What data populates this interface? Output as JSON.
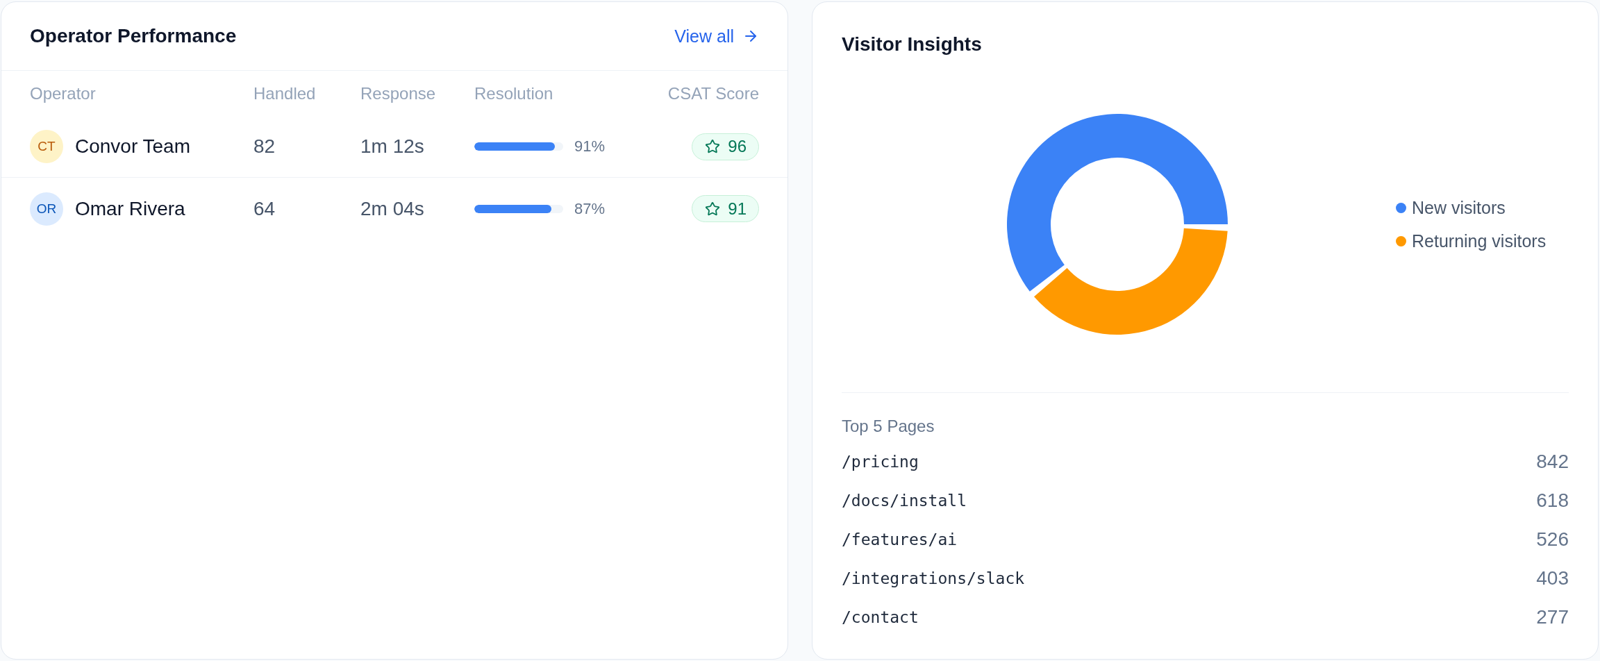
{
  "operator_performance": {
    "title": "Operator Performance",
    "view_all": {
      "label": "View all"
    },
    "columns": [
      "Operator",
      "Handled",
      "Response",
      "Resolution",
      "CSAT Score"
    ],
    "rows": [
      {
        "initials": "CT",
        "color": "#fef3c7",
        "name": "Convor Team",
        "handled": "82",
        "response": "1m 12s",
        "resolution": {
          "level": 0.91,
          "reading": "91%"
        },
        "csat": "96"
      },
      {
        "initials": "OR",
        "color": "#dbeafe",
        "name": "Omar Rivera",
        "handled": "64",
        "response": "2m 04s",
        "resolution": {
          "level": 0.87,
          "reading": "87%"
        },
        "csat": "91"
      }
    ]
  },
  "visitor_insights": {
    "title": "Visitor Insights",
    "legend": [
      {
        "label": "New visitors",
        "color": "#3b82f6"
      },
      {
        "label": "Returning visitors",
        "color": "#ff9900"
      }
    ],
    "top_pages": {
      "title": "Top 5 Pages",
      "rows": [
        {
          "path": "/pricing",
          "count": "842"
        },
        {
          "path": "/docs/install",
          "count": "618"
        },
        {
          "path": "/features/ai",
          "count": "526"
        },
        {
          "path": "/integrations/slack",
          "count": "403"
        },
        {
          "path": "/contact",
          "count": "277"
        }
      ]
    }
  }
}
